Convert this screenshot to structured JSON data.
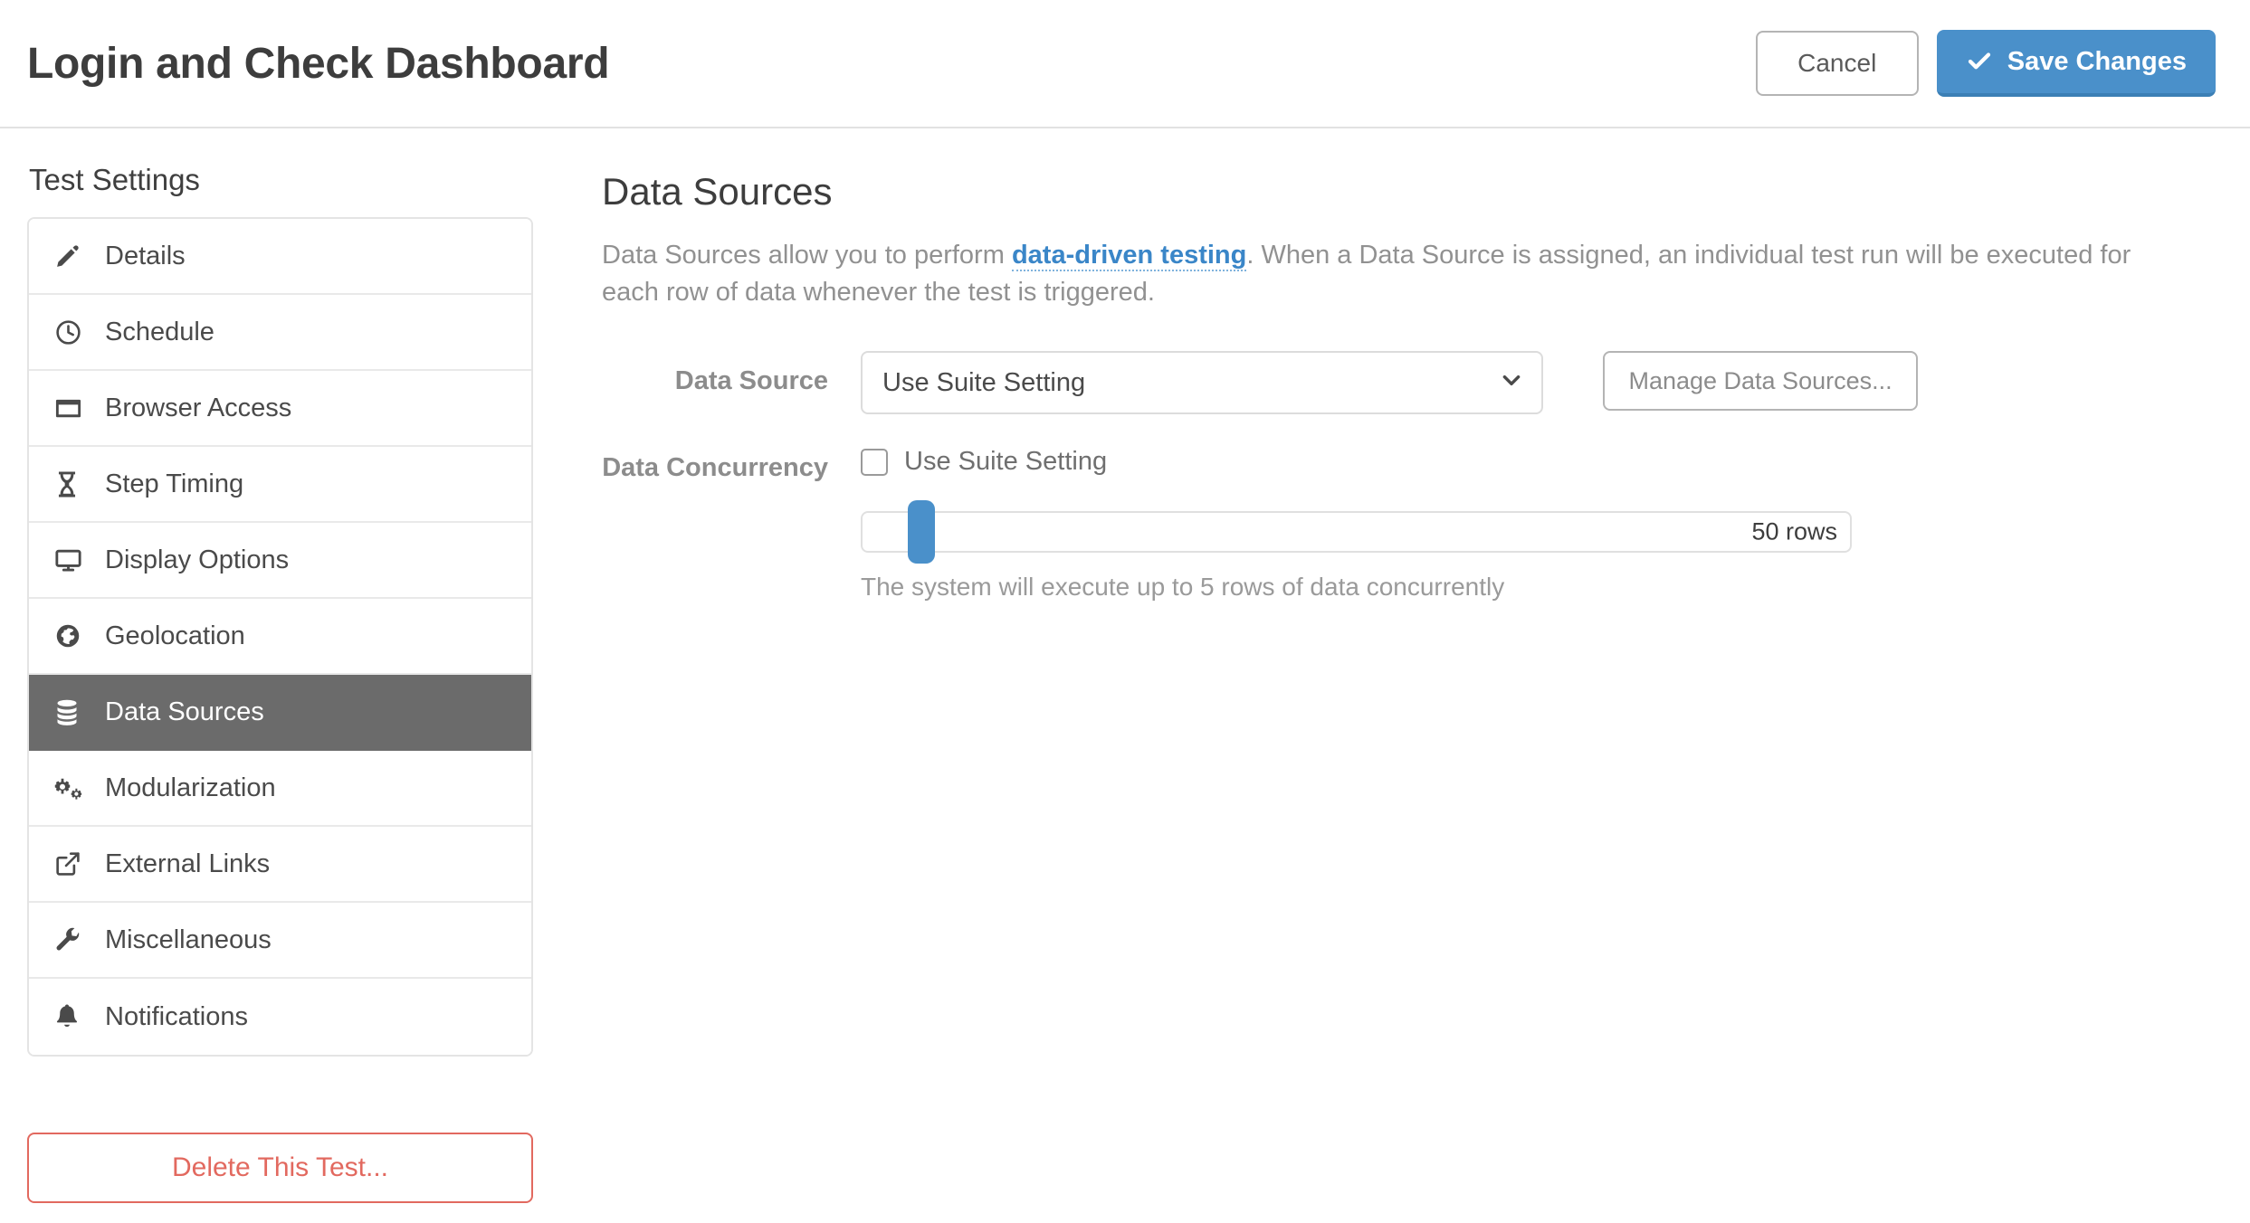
{
  "header": {
    "title": "Login and Check Dashboard",
    "cancel_label": "Cancel",
    "save_label": "Save Changes"
  },
  "sidebar": {
    "heading": "Test Settings",
    "items": [
      {
        "label": "Details",
        "icon": "pencil-icon",
        "active": false
      },
      {
        "label": "Schedule",
        "icon": "clock-icon",
        "active": false
      },
      {
        "label": "Browser Access",
        "icon": "browser-window-icon",
        "active": false
      },
      {
        "label": "Step Timing",
        "icon": "hourglass-icon",
        "active": false
      },
      {
        "label": "Display Options",
        "icon": "desktop-monitor-icon",
        "active": false
      },
      {
        "label": "Geolocation",
        "icon": "globe-icon",
        "active": false
      },
      {
        "label": "Data Sources",
        "icon": "database-icon",
        "active": true
      },
      {
        "label": "Modularization",
        "icon": "cogs-icon",
        "active": false
      },
      {
        "label": "External Links",
        "icon": "external-link-icon",
        "active": false
      },
      {
        "label": "Miscellaneous",
        "icon": "wrench-icon",
        "active": false
      },
      {
        "label": "Notifications",
        "icon": "bell-icon",
        "active": false
      }
    ],
    "delete_label": "Delete This Test..."
  },
  "main": {
    "title": "Data Sources",
    "description_part1": "Data Sources allow you to perform ",
    "description_link": "data-driven testing",
    "description_part2": ". When a Data Source is assigned, an individual test run will be executed for each row of data whenever the test is triggered.",
    "data_source": {
      "label": "Data Source",
      "selected_value": "Use Suite Setting",
      "manage_button_label": "Manage Data Sources..."
    },
    "data_concurrency": {
      "label": "Data Concurrency",
      "use_suite_setting_label": "Use Suite Setting",
      "use_suite_setting_checked": false,
      "current_value_label": "5 rows",
      "max_value_label": "50 rows",
      "help_text": "The system will execute up to 5 rows of data concurrently",
      "slider_percent": 6
    }
  },
  "colors": {
    "accent_blue": "#4a90ca",
    "link_blue": "#3a86c8",
    "active_nav_bg": "#6b6b6b",
    "danger_red": "#e2695f"
  }
}
